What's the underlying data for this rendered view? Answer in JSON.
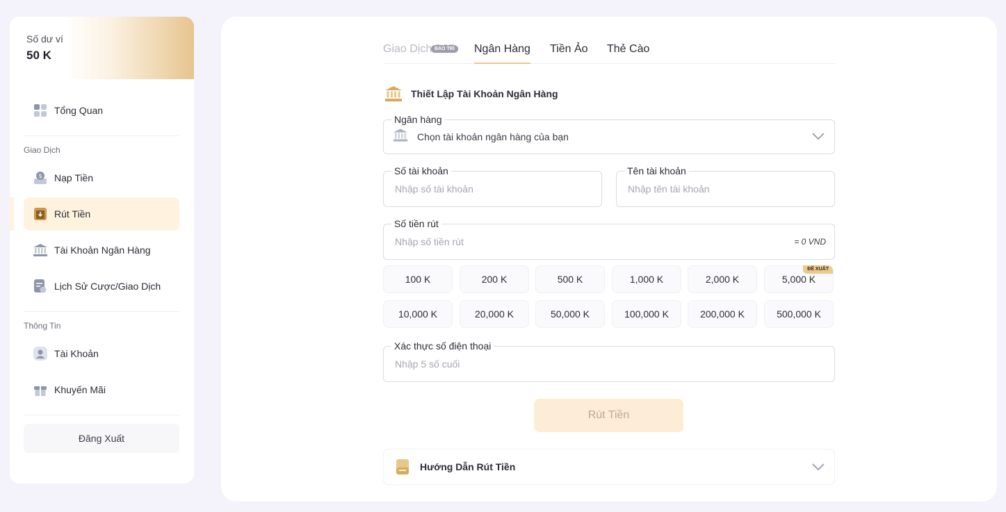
{
  "wallet": {
    "label": "Số dư ví",
    "value": "50 K"
  },
  "sidebar": {
    "overview": "Tổng Quan",
    "section_transactions": "Giao Dịch",
    "deposit": "Nạp Tiền",
    "withdraw": "Rút Tiền",
    "bank_account": "Tài Khoản Ngân Hàng",
    "history": "Lịch Sử Cược/Giao Dịch",
    "section_info": "Thông Tin",
    "account": "Tài Khoản",
    "promotions": "Khuyến Mãi",
    "logout": "Đăng Xuất"
  },
  "tabs": [
    {
      "label": "Giao Dịch P2P",
      "state": "disabled",
      "badge": "BẢO TRÌ"
    },
    {
      "label": "Ngân Hàng",
      "state": "active"
    },
    {
      "label": "Tiền Ảo",
      "state": "normal"
    },
    {
      "label": "Thẻ Cào",
      "state": "normal"
    }
  ],
  "form": {
    "section_title": "Thiết Lập Tài Khoản Ngân Hàng",
    "bank": {
      "label": "Ngân hàng",
      "value": "Chọn tài khoản ngân hàng của bạn"
    },
    "account_number": {
      "label": "Số tài khoản",
      "placeholder": "Nhập số tài khoản"
    },
    "account_name": {
      "label": "Tên tài khoản",
      "placeholder": "Nhập tên tài khoản"
    },
    "amount": {
      "label": "Số tiền rút",
      "placeholder": "Nhập số tiền rút",
      "suffix": "= 0 VND"
    },
    "amount_options": [
      "100 K",
      "200 K",
      "500 K",
      "1,000 K",
      "2,000 K",
      "5,000 K",
      "10,000 K",
      "20,000 K",
      "50,000 K",
      "100,000 K",
      "200,000 K",
      "500,000 K"
    ],
    "suggest_badge": "ĐỀ XUẤT",
    "phone": {
      "label": "Xác thực số điện thoại",
      "placeholder": "Nhập 5 số cuối"
    },
    "submit": "Rút Tiền",
    "guide": "Hướng Dẫn Rút Tiền"
  },
  "colors": {
    "accent": "#e7c88e",
    "active_bg": "#fff3df",
    "submit_bg": "#fdecd6",
    "page_bg": "#f4f3fb"
  }
}
